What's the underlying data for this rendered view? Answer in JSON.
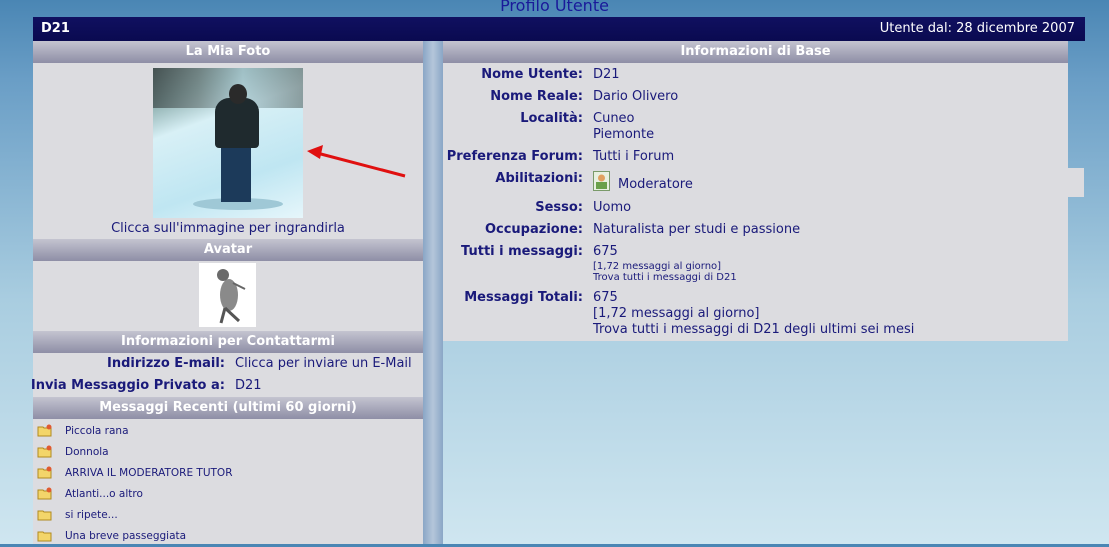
{
  "page_title": "Profilo Utente",
  "topbar": {
    "username": "D21",
    "member_since": "Utente dal: 28 dicembre 2007"
  },
  "left": {
    "photo_header": "La Mia Foto",
    "photo_caption": "Clicca sull'immagine per ingrandirla",
    "avatar_header": "Avatar",
    "contact_header": "Informazioni per Contattarmi",
    "email_label": "Indirizzo E-mail:",
    "email_value": "Clicca per inviare un E-Mail",
    "pm_label": "Invia Messaggio Privato a:",
    "pm_value": "D21",
    "recent_header": "Messaggi Recenti (ultimi 60 giorni)",
    "recent_posts": [
      {
        "title": "Piccola rana",
        "icon": "hot-folder-icon"
      },
      {
        "title": "Donnola",
        "icon": "hot-folder-icon"
      },
      {
        "title": "ARRIVA IL MODERATORE TUTOR",
        "icon": "hot-folder-icon"
      },
      {
        "title": "Atlanti...o altro",
        "icon": "hot-folder-icon"
      },
      {
        "title": "si ripete...",
        "icon": "folder-icon"
      },
      {
        "title": "Una breve passeggiata",
        "icon": "folder-icon"
      }
    ]
  },
  "right": {
    "header": "Informazioni di Base",
    "username_label": "Nome Utente:",
    "username_value": "D21",
    "realname_label": "Nome Reale:",
    "realname_value": "Dario Olivero",
    "location_label": "Località:",
    "location_value_1": "Cuneo",
    "location_value_2": "Piemonte",
    "forum_pref_label": "Preferenza Forum:",
    "forum_pref_value": "Tutti i Forum",
    "role_label": "Abilitazioni:",
    "role_value": "Moderatore",
    "sex_label": "Sesso:",
    "sex_value": "Uomo",
    "job_label": "Occupazione:",
    "job_value": "Naturalista per studi e passione",
    "all_msgs_label": "Tutti i messaggi:",
    "all_msgs_value": "675",
    "all_msgs_rate": "[1,72 messaggi al giorno]",
    "all_msgs_link": "Trova tutti i messaggi di D21",
    "total_msgs_label": "Messaggi Totali:",
    "total_msgs_value": "675",
    "total_msgs_rate": "[1,72 messaggi al giorno]",
    "total_msgs_link": "Trova tutti i messaggi di D21 degli ultimi sei mesi"
  },
  "colors": {
    "accent_navy": "#101060",
    "text_navy": "#1a1a7a",
    "arrow_red": "#e01010"
  }
}
